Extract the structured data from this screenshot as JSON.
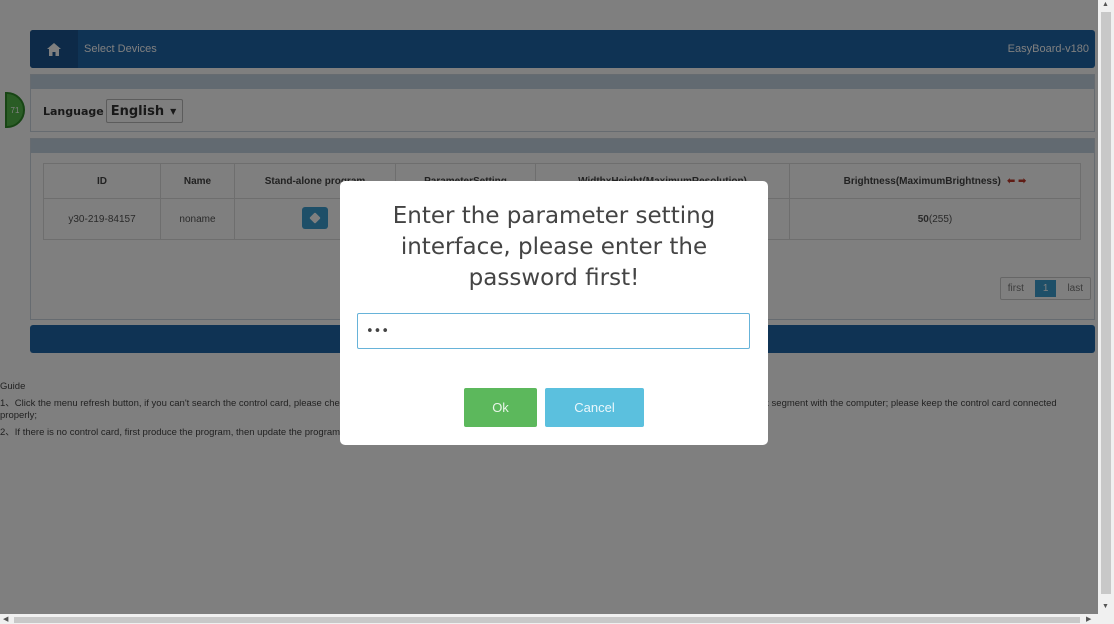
{
  "header": {
    "title": "Select Devices",
    "device_model": "EasyBoard-v180"
  },
  "badge": {
    "text": "71"
  },
  "language": {
    "label": "Language",
    "selected": "English",
    "caret": "▼"
  },
  "table": {
    "columns": [
      "ID",
      "Name",
      "Stand-alone program",
      "ParameterSetting",
      "WidthxHeight(MaximumResolution)",
      "Brightness(MaximumBrightness)"
    ],
    "brightness_arrows": "⬅ ➡",
    "rows": [
      {
        "id": "y30-219-84157",
        "name": "noname",
        "brightness_value": "50",
        "brightness_max": "(255)"
      }
    ]
  },
  "pager": {
    "first": "first",
    "current": "1",
    "last": "last"
  },
  "guide": {
    "title": "Guide",
    "items": [
      "1、Click the menu refresh button, if you can't search the control card, please check whether the control card is connected properly, and whether the control card is in the same network segment with the computer; please keep the control card connected properly;",
      "2、If there is no control card, first produce the program, then update the program through U disk. Please click on Offline Program to make the program."
    ]
  },
  "modal": {
    "title": "Enter the parameter setting interface, please enter the password first!",
    "password_value": "abc",
    "ok_label": "Ok",
    "cancel_label": "Cancel"
  },
  "colors": {
    "header": "#1f66a8",
    "ok": "#5cb85c",
    "cancel": "#5bc0de",
    "accent": "#3d9ed1"
  }
}
